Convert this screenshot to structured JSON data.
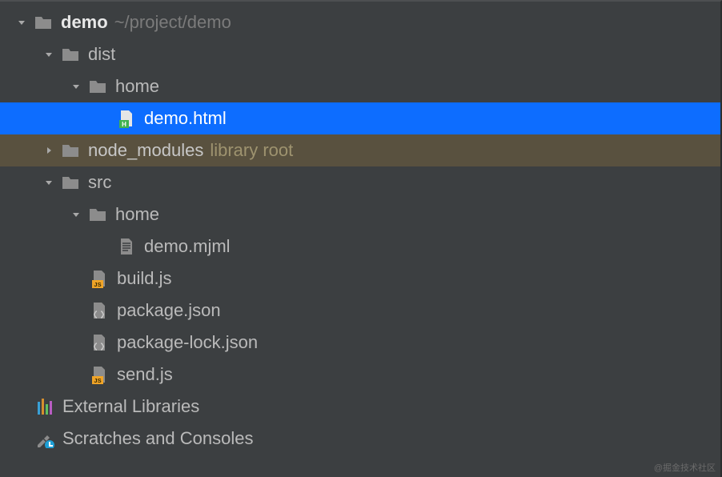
{
  "tree": {
    "root": {
      "name": "demo",
      "path": "~/project/demo"
    },
    "dist": "dist",
    "dist_home": "home",
    "demo_html": "demo.html",
    "node_modules": "node_modules",
    "node_modules_tag": "library root",
    "src": "src",
    "src_home": "home",
    "demo_mjml": "demo.mjml",
    "build_js": "build.js",
    "package_json": "package.json",
    "package_lock_json": "package-lock.json",
    "send_js": "send.js",
    "external_libraries": "External Libraries",
    "scratches": "Scratches and Consoles"
  },
  "watermark": "@掘金技术社区"
}
